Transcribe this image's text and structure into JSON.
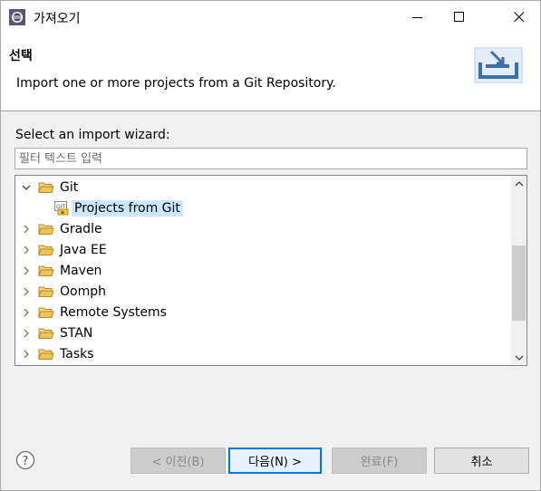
{
  "window": {
    "title": "가져오기",
    "controls": {
      "minimize": "minimize",
      "maximize": "maximize",
      "close": "close"
    }
  },
  "header": {
    "title": "선택",
    "description": "Import one or more projects from a Git Repository."
  },
  "wizard": {
    "select_label": "Select an import wizard:",
    "filter_placeholder": "필터 텍스트 입력",
    "tree": [
      {
        "label": "Git",
        "expanded": true,
        "icon": "folder-open-icon"
      },
      {
        "label": "Projects from Git",
        "child": true,
        "selected": true,
        "icon": "git-import-icon"
      },
      {
        "label": "Gradle",
        "expanded": false,
        "icon": "folder-icon"
      },
      {
        "label": "Java EE",
        "expanded": false,
        "icon": "folder-icon"
      },
      {
        "label": "Maven",
        "expanded": false,
        "icon": "folder-icon"
      },
      {
        "label": "Oomph",
        "expanded": false,
        "icon": "folder-icon"
      },
      {
        "label": "Remote Systems",
        "expanded": false,
        "icon": "folder-icon"
      },
      {
        "label": "STAN",
        "expanded": false,
        "icon": "folder-icon"
      },
      {
        "label": "Tasks",
        "expanded": false,
        "icon": "folder-icon"
      }
    ]
  },
  "buttons": {
    "back": "< 이전(B)",
    "next": "다음(N) >",
    "finish": "완료(F)",
    "cancel": "취소"
  },
  "colors": {
    "selection": "#cce8ff",
    "default_button_border": "#0078d7",
    "folder": "#e8b84a"
  }
}
